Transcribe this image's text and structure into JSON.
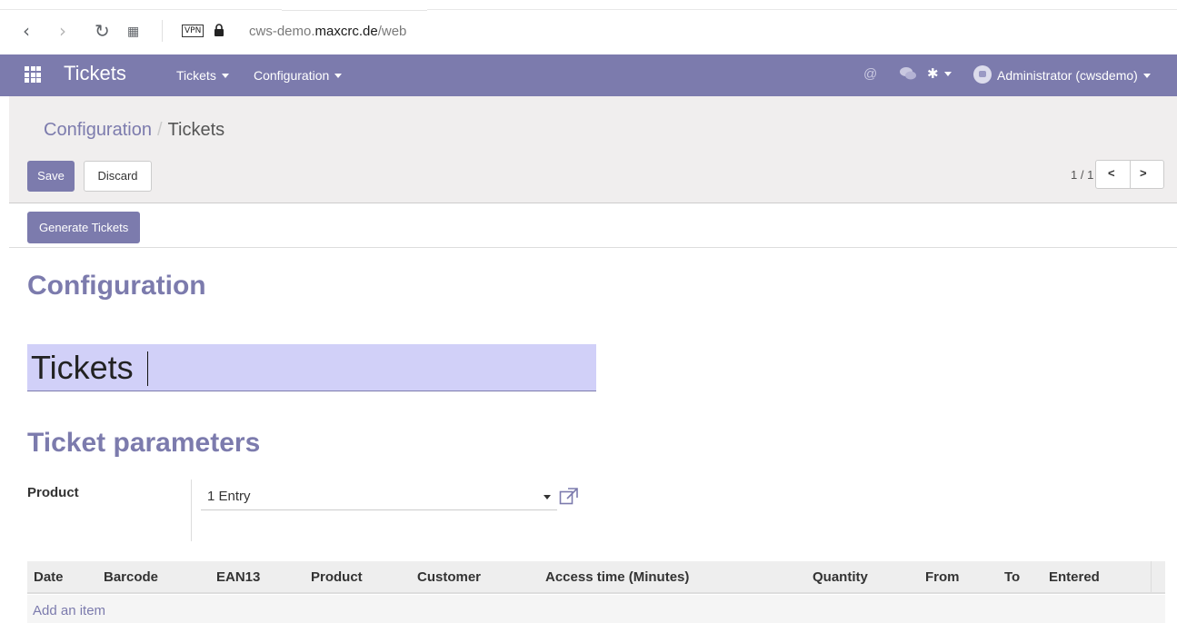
{
  "browser": {
    "vpn_label": "VPN",
    "url_prefix": "cws-demo.",
    "url_domain": "maxcrc.de",
    "url_path": "/web"
  },
  "navbar": {
    "app_name": "Tickets",
    "menus": [
      "Tickets",
      "Configuration"
    ],
    "user": "Administrator (cwsdemo)",
    "brand_color": "#7c7bad"
  },
  "breadcrumb": {
    "parent": "Configuration",
    "separator": "/",
    "current": "Tickets"
  },
  "buttons": {
    "save": "Save",
    "discard": "Discard",
    "generate": "Generate Tickets"
  },
  "pager": {
    "text": "1 / 1"
  },
  "form": {
    "heading": "Configuration",
    "name_value": "Tickets",
    "section_heading": "Ticket parameters",
    "product_label": "Product",
    "product_value": "1 Entry"
  },
  "table": {
    "columns": [
      "Date",
      "Barcode",
      "EAN13",
      "Product",
      "Customer",
      "Access time (Minutes)",
      "Quantity",
      "From",
      "To",
      "Entered"
    ],
    "add_item": "Add an item"
  }
}
